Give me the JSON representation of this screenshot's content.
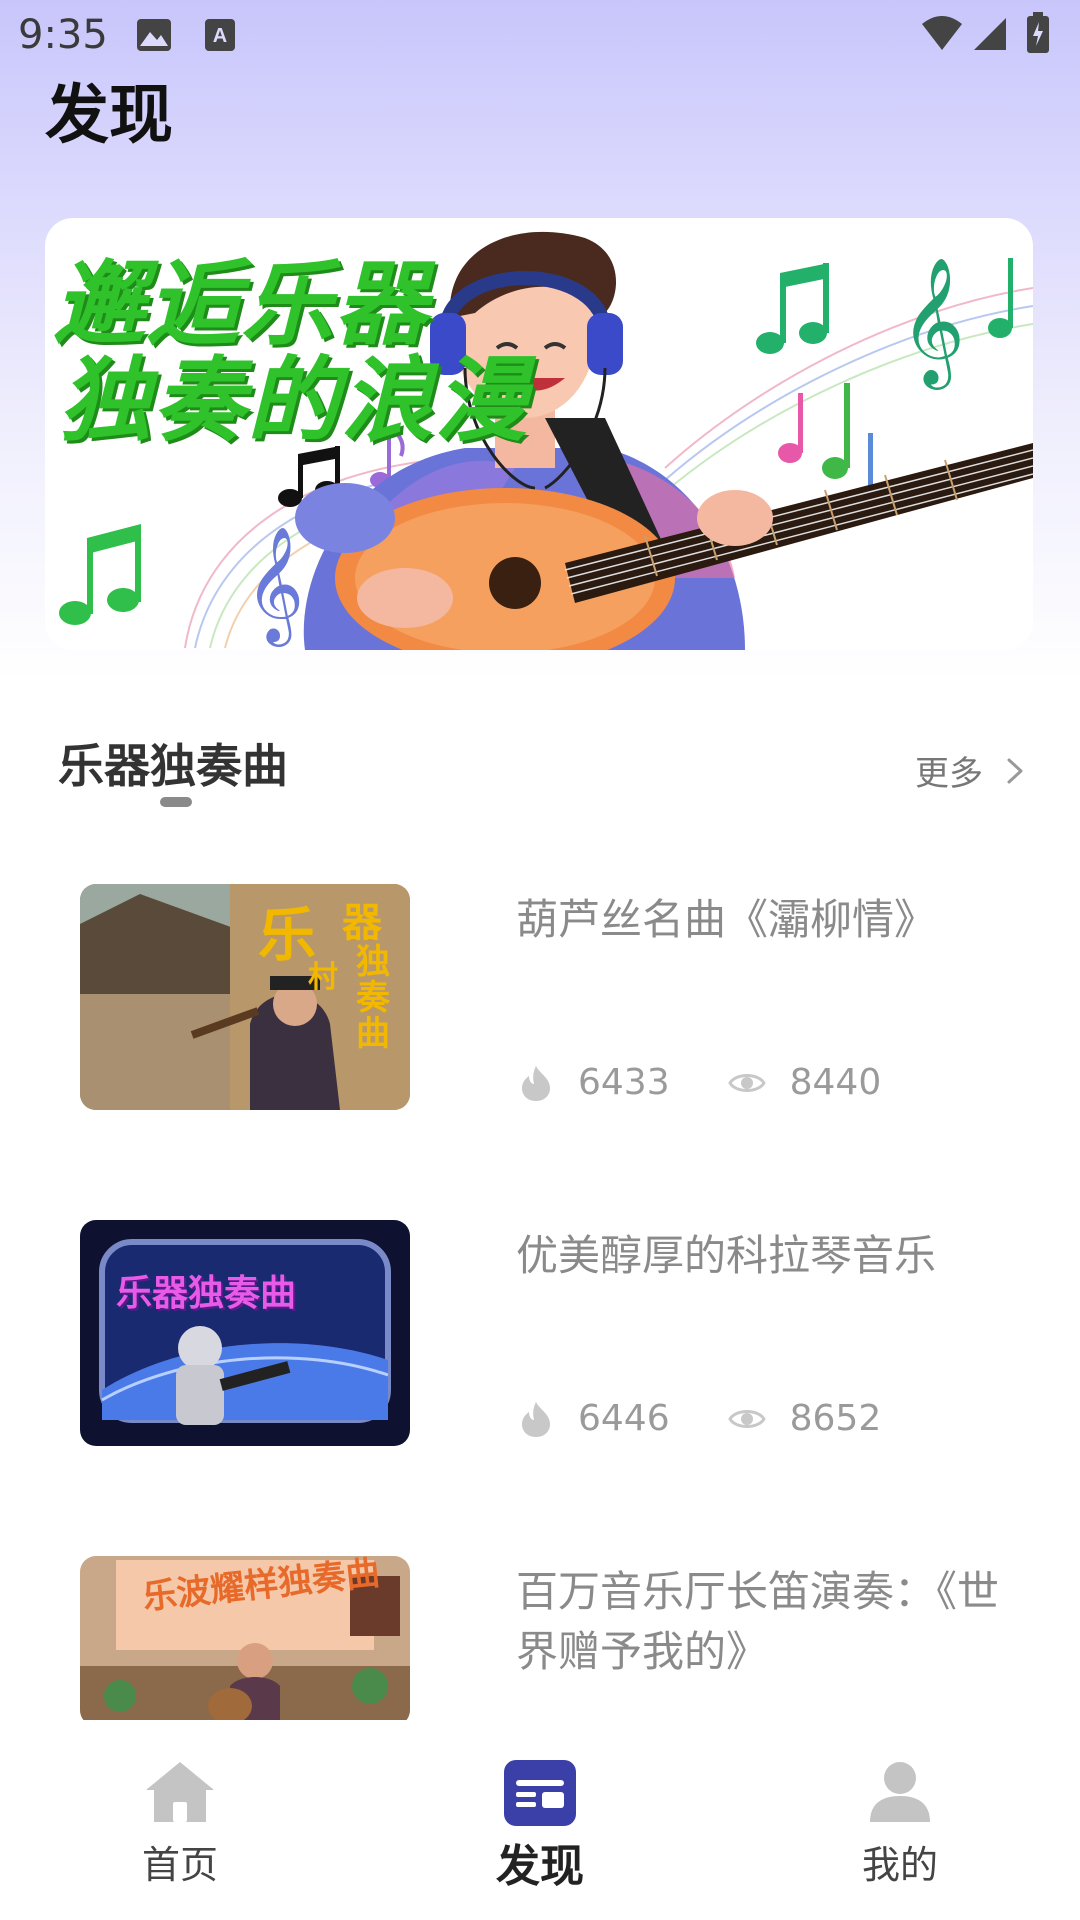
{
  "status_bar": {
    "time": "9:35"
  },
  "page": {
    "title": "发现"
  },
  "banner": {
    "line1": "邂逅乐器",
    "line2": "独奏的浪漫"
  },
  "section": {
    "title": "乐器独奏曲",
    "more": "更多"
  },
  "items": [
    {
      "title": "葫芦丝名曲《灞柳情》",
      "likes": "6433",
      "views": "8440",
      "thumb_text": [
        "乐",
        "器",
        "独",
        "奏",
        "曲",
        "村"
      ]
    },
    {
      "title": "优美醇厚的科拉琴音乐",
      "likes": "6446",
      "views": "8652",
      "thumb_text": "乐器独奏曲"
    },
    {
      "title": "百万音乐厅长笛演奏：《世界赠予我的》",
      "thumb_text": "乐波耀样独奏曲"
    }
  ],
  "nav": [
    {
      "label": "首页",
      "icon": "home-icon"
    },
    {
      "label": "发现",
      "icon": "discover-icon",
      "active": true
    },
    {
      "label": "我的",
      "icon": "profile-icon"
    }
  ],
  "colors": {
    "accent": "#3b3fa8",
    "banner_text": "#2fc22b",
    "title": "#111111",
    "muted": "#8a8a8a"
  }
}
